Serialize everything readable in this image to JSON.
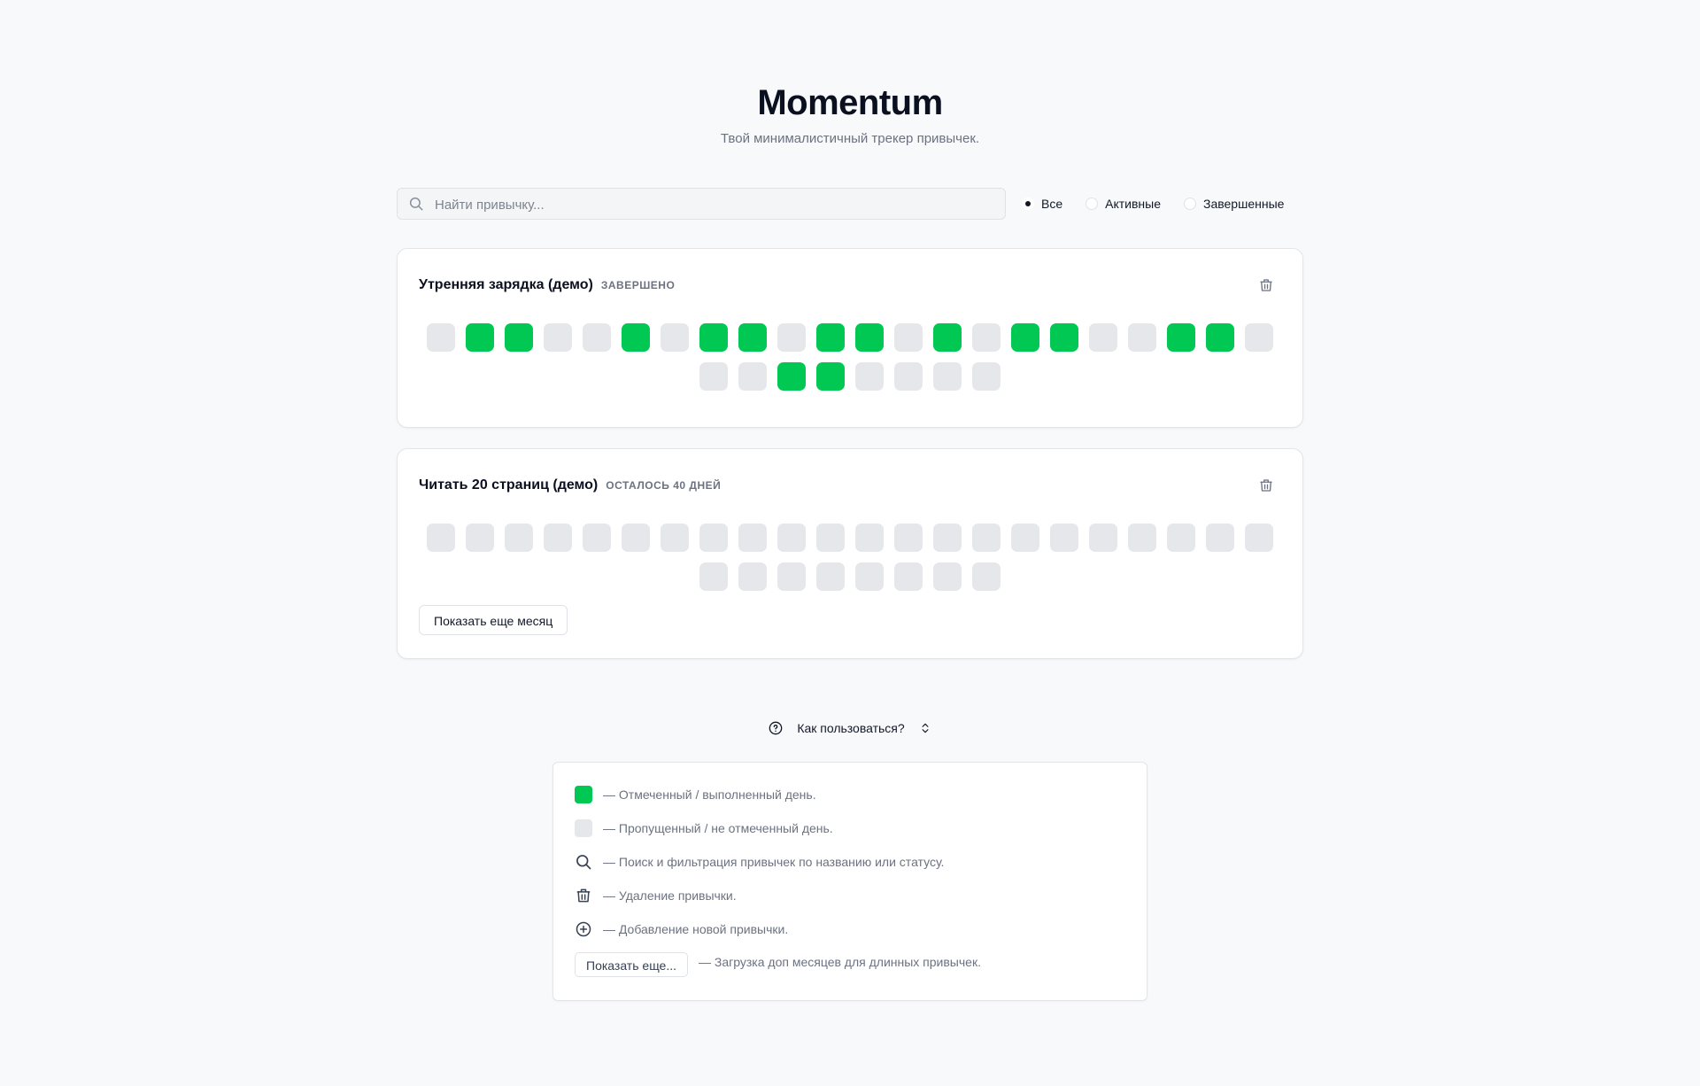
{
  "app": {
    "title": "Momentum",
    "subtitle": "Твой минималистичный трекер привычек."
  },
  "search": {
    "placeholder": "Найти привычку...",
    "value": ""
  },
  "filters": [
    {
      "label": "Все",
      "selected": true
    },
    {
      "label": "Активные",
      "selected": false
    },
    {
      "label": "Завершенные",
      "selected": false
    }
  ],
  "habits": [
    {
      "name": "Утренняя зарядка (демо)",
      "status": "ЗАВЕРШЕНО",
      "days": [
        0,
        1,
        1,
        0,
        0,
        1,
        0,
        1,
        1,
        0,
        1,
        1,
        0,
        1,
        0,
        1,
        1,
        0,
        0,
        1,
        1,
        0,
        0,
        0,
        1,
        1,
        0,
        0,
        0,
        0
      ]
    },
    {
      "name": "Читать 20 страниц (демо)",
      "status": "ОСТАЛОСЬ 40 ДНЕЙ",
      "days": [
        0,
        0,
        0,
        0,
        0,
        0,
        0,
        0,
        0,
        0,
        0,
        0,
        0,
        0,
        0,
        0,
        0,
        0,
        0,
        0,
        0,
        0,
        0,
        0,
        0,
        0,
        0,
        0,
        0,
        0
      ],
      "show_more_label": "Показать еще месяц"
    }
  ],
  "help": {
    "toggle_label": "Как пользоваться?",
    "items": [
      {
        "icon": "checked-day-swatch",
        "text": "— Отмеченный / выполненный день."
      },
      {
        "icon": "missed-day-swatch",
        "text": "— Пропущенный / не отмеченный день."
      },
      {
        "icon": "search-icon",
        "text": "— Поиск и фильтрация привычек по названию или статусу."
      },
      {
        "icon": "trash-icon",
        "text": "— Удаление привычки."
      },
      {
        "icon": "plus-circle-icon",
        "text": "— Добавление новой привычки."
      },
      {
        "icon": "show-more-button",
        "button_label": "Показать еще...",
        "text": "— Загрузка доп месяцев для длинных привычек."
      }
    ]
  },
  "colors": {
    "done": "#00c853",
    "empty": "#e5e7eb",
    "background": "#f8f9fb"
  }
}
